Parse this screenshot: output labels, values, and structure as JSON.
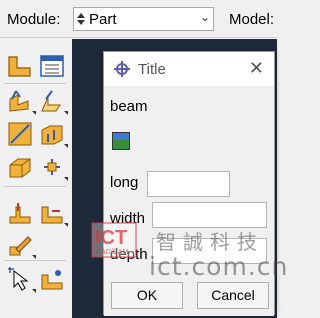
{
  "topbar": {
    "module_label": "Module:",
    "module_value": "Part",
    "model_label": "Model:"
  },
  "toolbox": {
    "icons": [
      "create-part-icon",
      "part-manager-icon",
      "create-solid-extrude-icon",
      "create-shell-icon",
      "create-wire-icon",
      "create-cut-icon",
      "create-round-icon",
      "create-datum-icon",
      "partition-face-icon",
      "partition-edge-icon",
      "edit-feature-icon",
      "select-query-icon",
      "create-reference-icon"
    ]
  },
  "dialog": {
    "title": "Title",
    "close_glyph": "✕",
    "name": "beam",
    "image_icon": "landscape-image-icon",
    "fields": [
      {
        "label": "long",
        "value": ""
      },
      {
        "label": "width",
        "value": ""
      },
      {
        "label": "depth",
        "value": ""
      }
    ],
    "ok_label": "OK",
    "cancel_label": "Cancel"
  },
  "watermark": {
    "logo_text": "ICT",
    "logo_subtext": "CAD/CAM",
    "chinese_text": "智誠科技",
    "url_text": "ict.com.cn"
  },
  "colors": {
    "viewport_bg": "#1f2a3a",
    "dialog_bg": "#f0f0f0",
    "watermark_red": "#d7363a"
  }
}
